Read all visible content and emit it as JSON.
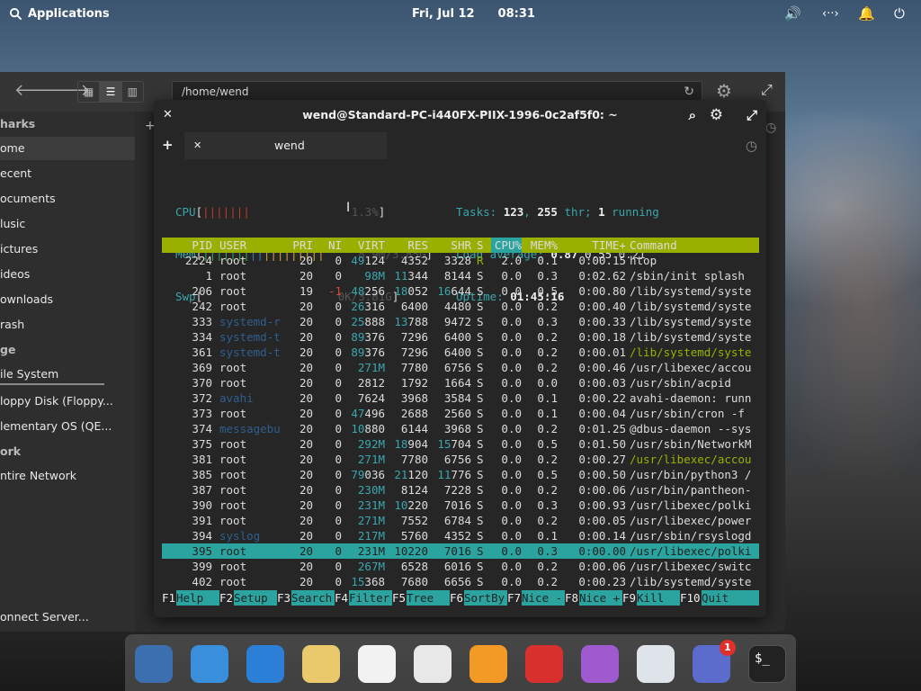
{
  "panel": {
    "applications": "Applications",
    "date": "Fri, Jul 12",
    "time": "08:31"
  },
  "files": {
    "path": "/home/wend",
    "sidebar": [
      {
        "label": "harks",
        "kind": "head",
        "top": 0
      },
      {
        "label": "ome",
        "kind": "selected"
      },
      {
        "label": "ecent"
      },
      {
        "label": "ocuments"
      },
      {
        "label": "lusic"
      },
      {
        "label": "ictures"
      },
      {
        "label": "ideos"
      },
      {
        "label": "ownloads"
      },
      {
        "label": "rash"
      },
      {
        "label": "ge",
        "kind": "head"
      },
      {
        "label": "ile System"
      },
      {
        "label": "loppy Disk (Floppy..."
      },
      {
        "label": "lementary OS (QE..."
      },
      {
        "label": "ork",
        "kind": "head"
      },
      {
        "label": "ntire Network"
      },
      {
        "label": "onnect Server..."
      }
    ]
  },
  "terminal": {
    "title": "wend@Standard-PC-i440FX-PIIX-1996-0c2af5f0: ~",
    "tab": "wend",
    "meters": {
      "cpu_label": "CPU",
      "cpu_value": "1.3%",
      "mem_label": "Mem",
      "mem_value": "8.9M/3.85G",
      "swp_label": "Swp",
      "swp_value": "0K/3.81G",
      "tasks_label": "Tasks:",
      "tasks": "123",
      "threads": "255",
      "thr_label": "thr;",
      "running": "1",
      "running_label": "running",
      "load_label": "Load average:",
      "load1": "0.87",
      "load5": "0.55",
      "load15": "0.21",
      "uptime_label": "Uptime:",
      "uptime": "01:45:16"
    },
    "columns": [
      "PID",
      "USER",
      "PRI",
      "NI",
      "VIRT",
      "RES",
      "SHR",
      "S",
      "CPU%",
      "MEM%",
      "TIME+",
      "Command"
    ],
    "rows": [
      [
        "2224",
        "root",
        "20",
        "0",
        "49124",
        "4352",
        "3328",
        "R",
        "2.0",
        "0.1",
        "0:00.15",
        "htop"
      ],
      [
        "1",
        "root",
        "20",
        "0",
        "98M",
        "11344",
        "8144",
        "S",
        "0.0",
        "0.3",
        "0:02.62",
        "/sbin/init splash"
      ],
      [
        "206",
        "root",
        "19",
        "-1",
        "48256",
        "18052",
        "16644",
        "S",
        "0.0",
        "0.5",
        "0:00.80",
        "/lib/systemd/syste"
      ],
      [
        "242",
        "root",
        "20",
        "0",
        "26316",
        "6400",
        "4480",
        "S",
        "0.0",
        "0.2",
        "0:00.40",
        "/lib/systemd/syste"
      ],
      [
        "333",
        "systemd-r",
        "20",
        "0",
        "25888",
        "13788",
        "9472",
        "S",
        "0.0",
        "0.3",
        "0:00.33",
        "/lib/systemd/syste"
      ],
      [
        "334",
        "systemd-t",
        "20",
        "0",
        "89376",
        "7296",
        "6400",
        "S",
        "0.0",
        "0.2",
        "0:00.18",
        "/lib/systemd/syste"
      ],
      [
        "361",
        "systemd-t",
        "20",
        "0",
        "89376",
        "7296",
        "6400",
        "S",
        "0.0",
        "0.2",
        "0:00.01",
        "/lib/systemd/syste"
      ],
      [
        "369",
        "root",
        "20",
        "0",
        "271M",
        "7780",
        "6756",
        "S",
        "0.0",
        "0.2",
        "0:00.46",
        "/usr/libexec/accou"
      ],
      [
        "370",
        "root",
        "20",
        "0",
        "2812",
        "1792",
        "1664",
        "S",
        "0.0",
        "0.0",
        "0:00.03",
        "/usr/sbin/acpid"
      ],
      [
        "372",
        "avahi",
        "20",
        "0",
        "7624",
        "3968",
        "3584",
        "S",
        "0.0",
        "0.1",
        "0:00.22",
        "avahi-daemon: runn"
      ],
      [
        "373",
        "root",
        "20",
        "0",
        "47496",
        "2688",
        "2560",
        "S",
        "0.0",
        "0.1",
        "0:00.04",
        "/usr/sbin/cron -f"
      ],
      [
        "374",
        "messagebu",
        "20",
        "0",
        "10880",
        "6144",
        "3968",
        "S",
        "0.0",
        "0.2",
        "0:01.25",
        "@dbus-daemon --sys"
      ],
      [
        "375",
        "root",
        "20",
        "0",
        "292M",
        "18904",
        "15704",
        "S",
        "0.0",
        "0.5",
        "0:01.50",
        "/usr/sbin/NetworkM"
      ],
      [
        "381",
        "root",
        "20",
        "0",
        "271M",
        "7780",
        "6756",
        "S",
        "0.0",
        "0.2",
        "0:00.27",
        "/usr/libexec/accou"
      ],
      [
        "385",
        "root",
        "20",
        "0",
        "79036",
        "21120",
        "11776",
        "S",
        "0.0",
        "0.5",
        "0:00.50",
        "/usr/bin/python3 /"
      ],
      [
        "387",
        "root",
        "20",
        "0",
        "230M",
        "8124",
        "7228",
        "S",
        "0.0",
        "0.2",
        "0:00.06",
        "/usr/bin/pantheon-"
      ],
      [
        "390",
        "root",
        "20",
        "0",
        "231M",
        "10220",
        "7016",
        "S",
        "0.0",
        "0.3",
        "0:00.93",
        "/usr/libexec/polki"
      ],
      [
        "391",
        "root",
        "20",
        "0",
        "271M",
        "7552",
        "6784",
        "S",
        "0.0",
        "0.2",
        "0:00.05",
        "/usr/libexec/power"
      ],
      [
        "394",
        "syslog",
        "20",
        "0",
        "217M",
        "5760",
        "4352",
        "S",
        "0.0",
        "0.1",
        "0:00.14",
        "/usr/sbin/rsyslogd"
      ],
      [
        "395",
        "root",
        "20",
        "0",
        "231M",
        "10220",
        "7016",
        "S",
        "0.0",
        "0.3",
        "0:00.00",
        "/usr/libexec/polki"
      ],
      [
        "399",
        "root",
        "20",
        "0",
        "267M",
        "6528",
        "6016",
        "S",
        "0.0",
        "0.2",
        "0:00.06",
        "/usr/libexec/switc"
      ],
      [
        "402",
        "root",
        "20",
        "0",
        "15368",
        "7680",
        "6656",
        "S",
        "0.0",
        "0.2",
        "0:00.23",
        "/lib/systemd/syste"
      ]
    ],
    "selected_row": 19,
    "footer": [
      {
        "key": "F1",
        "label": "Help"
      },
      {
        "key": "F2",
        "label": "Setup"
      },
      {
        "key": "F3",
        "label": "Search"
      },
      {
        "key": "F4",
        "label": "Filter"
      },
      {
        "key": "F5",
        "label": "Tree"
      },
      {
        "key": "F6",
        "label": "SortBy"
      },
      {
        "key": "F7",
        "label": "Nice -"
      },
      {
        "key": "F8",
        "label": "Nice +"
      },
      {
        "key": "F9",
        "label": "Kill"
      },
      {
        "key": "F10",
        "label": "Quit"
      }
    ]
  },
  "dock": [
    {
      "name": "multitasking-view",
      "color": "#3c6fb0"
    },
    {
      "name": "files",
      "color": "#3a8fdc"
    },
    {
      "name": "web-browser",
      "color": "#2b7fd6"
    },
    {
      "name": "mail",
      "color": "#e9c96b"
    },
    {
      "name": "tasks",
      "color": "#f2f2f2"
    },
    {
      "name": "calendar",
      "color": "#e8e8e8"
    },
    {
      "name": "music",
      "color": "#f39a26"
    },
    {
      "name": "videos",
      "color": "#d8302c"
    },
    {
      "name": "photos",
      "color": "#a05ad0"
    },
    {
      "name": "system-settings",
      "color": "#dfe4ea"
    },
    {
      "name": "appcenter",
      "color": "#5b6ccd",
      "badge": "1"
    },
    {
      "name": "terminal",
      "color": "#222222",
      "glyph": "$_"
    }
  ]
}
